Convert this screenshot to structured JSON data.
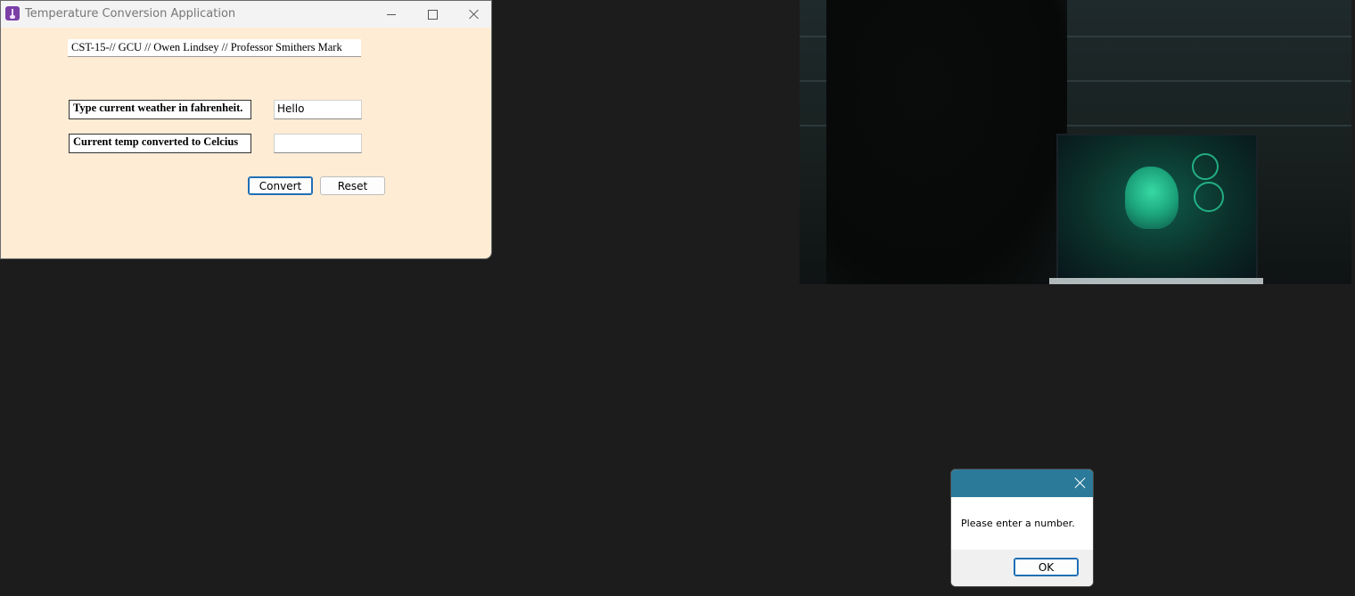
{
  "window": {
    "title": "Temperature Conversion Application",
    "course_info": "CST-15-// GCU // Owen Lindsey // Professor Smithers Mark",
    "fahrenheit_label": "Type current weather in fahrenheit.",
    "fahrenheit_value": "Hello",
    "celsius_label": "Current temp converted to Celcius",
    "celsius_value": "",
    "convert_label": "Convert",
    "reset_label": "Reset"
  },
  "dialog": {
    "message": "Please enter a number.",
    "ok_label": "OK"
  },
  "colors": {
    "window_bg": "#feecd4",
    "desktop_bg": "#1c1c1c",
    "dialog_titlebar": "#2b7a99",
    "focus_border": "#1f6fb5"
  },
  "icons": {
    "app": "thermometer-icon",
    "minimize": "minimize-icon",
    "maximize": "maximize-icon",
    "close": "close-icon",
    "dialog_close": "close-icon"
  }
}
